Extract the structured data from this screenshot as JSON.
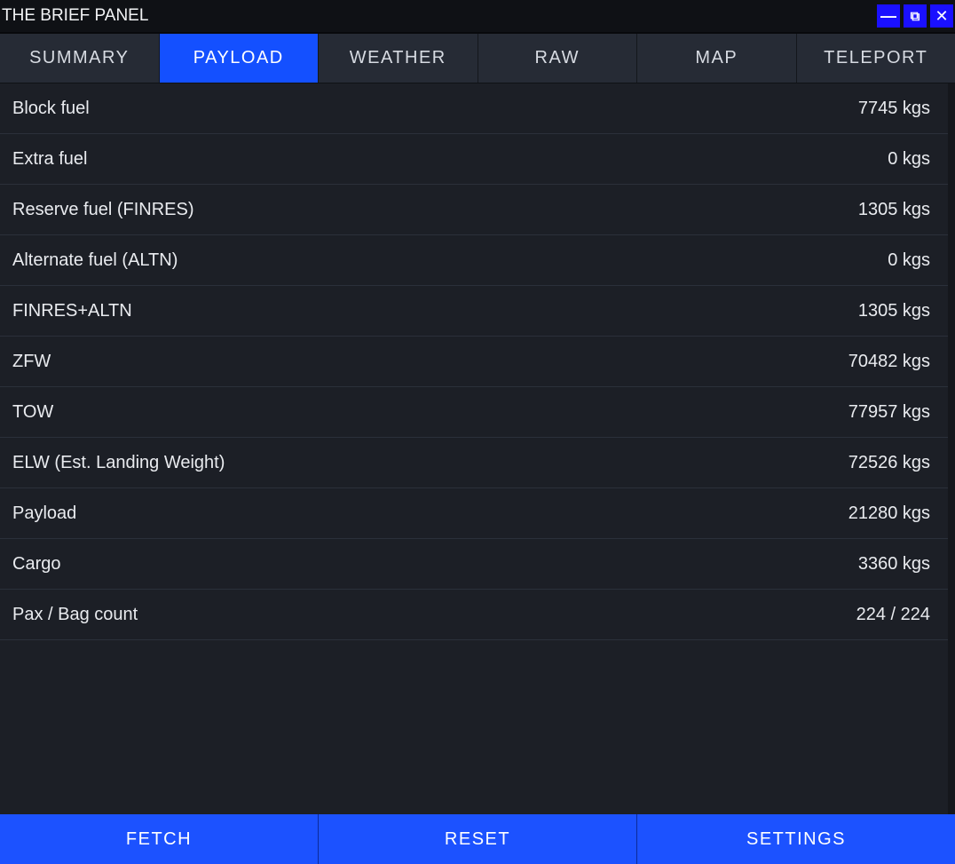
{
  "window": {
    "title": "THE BRIEF PANEL",
    "buttons": {
      "minimize": "—",
      "popout": "⧉",
      "close": "✕"
    }
  },
  "tabs": [
    {
      "label": "SUMMARY",
      "active": false
    },
    {
      "label": "PAYLOAD",
      "active": true
    },
    {
      "label": "WEATHER",
      "active": false
    },
    {
      "label": "RAW",
      "active": false
    },
    {
      "label": "MAP",
      "active": false
    },
    {
      "label": "TELEPORT",
      "active": false
    }
  ],
  "payload": {
    "rows": [
      {
        "label": "Block fuel",
        "value": "7745 kgs"
      },
      {
        "label": "Extra fuel",
        "value": "0 kgs"
      },
      {
        "label": "Reserve fuel (FINRES)",
        "value": "1305 kgs"
      },
      {
        "label": "Alternate fuel (ALTN)",
        "value": "0 kgs"
      },
      {
        "label": "FINRES+ALTN",
        "value": "1305 kgs"
      },
      {
        "label": "ZFW",
        "value": "70482 kgs"
      },
      {
        "label": "TOW",
        "value": "77957 kgs"
      },
      {
        "label": "ELW (Est. Landing Weight)",
        "value": "72526 kgs"
      },
      {
        "label": "Payload",
        "value": "21280 kgs"
      },
      {
        "label": "Cargo",
        "value": "3360 kgs"
      },
      {
        "label": "Pax / Bag count",
        "value": "224 / 224"
      }
    ]
  },
  "footer": {
    "fetch": "FETCH",
    "reset": "RESET",
    "settings": "SETTINGS"
  },
  "colors": {
    "accent": "#1450ff",
    "window_button": "#1a10ff",
    "background": "#1c1f26",
    "tab_bar": "#262b35"
  }
}
